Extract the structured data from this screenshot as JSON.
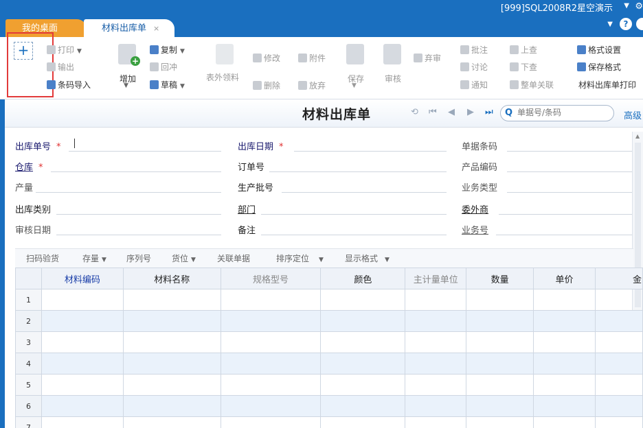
{
  "titlebar": {
    "db_label": "[999]SQL2008R2星空演示"
  },
  "tabs": [
    {
      "label": "我的桌面"
    },
    {
      "label": "材料出库单",
      "close": "×"
    }
  ],
  "toolbar": {
    "new_label": "+",
    "print": "打印",
    "export": "输出",
    "barcode_import": "条码导入",
    "add": "增加",
    "copy": "复制",
    "reverse": "回冲",
    "draft": "草稿",
    "outside_pick": "表外领料",
    "modify": "修改",
    "attach": "附件",
    "delete": "删除",
    "abandon": "放弃",
    "save": "保存",
    "audit": "审核",
    "reject_audit": "弃审",
    "annotate": "批注",
    "discuss": "讨论",
    "notify": "通知",
    "prev_check": "上查",
    "next_check": "下查",
    "whole_link": "整单关联",
    "format_settings": "格式设置",
    "save_format": "保存格式",
    "print_doc": "材料出库单打印"
  },
  "form": {
    "title": "材料出库单",
    "search_placeholder": "单据号/条码",
    "advanced": "高级",
    "fields": {
      "out_no": "出库单号",
      "out_date": "出库日期",
      "doc_barcode": "单据条码",
      "warehouse": "仓库",
      "order_no": "订单号",
      "product_code": "产品编码",
      "output": "产量",
      "batch_no": "生产批号",
      "biz_type": "业务类型",
      "out_category": "出库类别",
      "department": "部门",
      "subcontractor": "委外商",
      "audit_date": "审核日期",
      "remark": "备注",
      "biz_no": "业务号"
    },
    "required_mark": "*"
  },
  "grid_toolbar": {
    "scan_check": "扫码验货",
    "stock": "存量",
    "serial": "序列号",
    "location": "货位",
    "link_doc": "关联单据",
    "sort_locate": "排序定位",
    "display_format": "显示格式"
  },
  "table": {
    "columns": [
      "",
      "材料编码",
      "材料名称",
      "规格型号",
      "颜色",
      "主计量单位",
      "数量",
      "单价",
      "金"
    ],
    "rows": [
      "1",
      "2",
      "3",
      "4",
      "5",
      "6",
      "7"
    ]
  }
}
